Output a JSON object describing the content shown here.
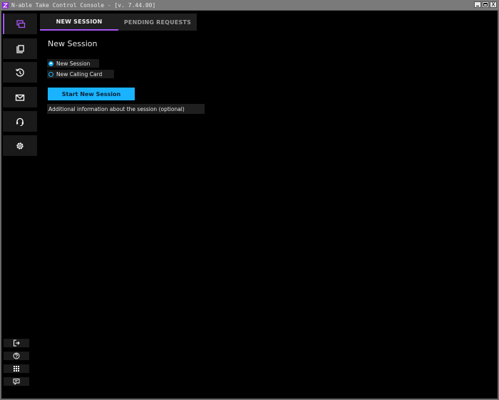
{
  "window": {
    "title": "N-able Take Control Console - [v. 7.44.00]",
    "icon": "take-control-logo-icon",
    "controls": [
      "minimize",
      "maximize",
      "close"
    ],
    "close_glyph": "X"
  },
  "sidebar": {
    "items": [
      {
        "name": "sessions",
        "icon": "windows-stack-icon",
        "active": true
      },
      {
        "name": "clipboard",
        "icon": "clipboard-icon",
        "active": false
      },
      {
        "name": "history",
        "icon": "history-icon",
        "active": false
      },
      {
        "name": "messages",
        "icon": "envelope-icon",
        "active": false
      },
      {
        "name": "support",
        "icon": "headset-icon",
        "active": false
      },
      {
        "name": "settings",
        "icon": "gear-icon",
        "active": false
      }
    ],
    "bottom_items": [
      {
        "name": "logout",
        "icon": "logout-icon"
      },
      {
        "name": "help",
        "icon": "help-icon"
      },
      {
        "name": "apps",
        "icon": "grid-icon"
      },
      {
        "name": "feedback",
        "icon": "feedback-icon"
      }
    ]
  },
  "tabs": [
    {
      "label": "NEW SESSION",
      "active": true
    },
    {
      "label": "PENDING REQUESTS",
      "active": false
    }
  ],
  "main": {
    "title": "New Session",
    "options": [
      {
        "label": "New Session",
        "selected": true
      },
      {
        "label": "New Calling Card",
        "selected": false
      }
    ],
    "start_button": "Start New Session",
    "info_placeholder": "Additional information about the session (optional)"
  },
  "colors": {
    "accent": "#a855f7",
    "primary_button": "#1ab3ff",
    "background": "#000000",
    "panel": "#1c1c1c"
  }
}
